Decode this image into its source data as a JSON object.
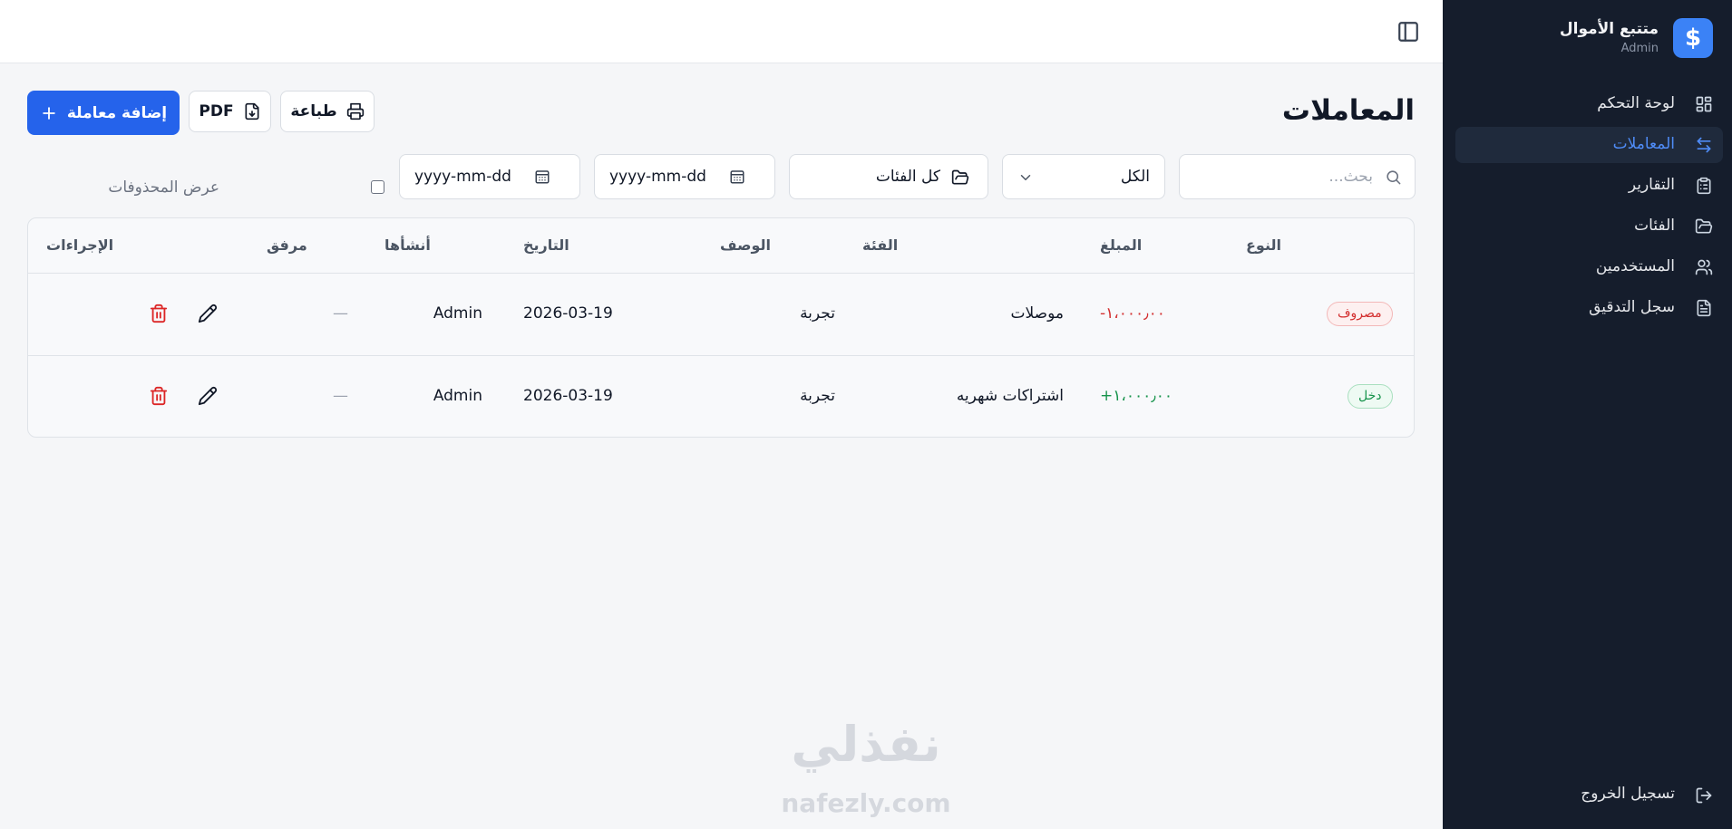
{
  "app": {
    "title": "متتبع الأموال",
    "user_role": "Admin",
    "logo_glyph": "$"
  },
  "sidebar": {
    "items": [
      {
        "label": "لوحة التحكم",
        "icon": "dashboard-grid-icon",
        "active": false
      },
      {
        "label": "المعاملات",
        "icon": "arrows-exchange-icon",
        "active": true
      },
      {
        "label": "التقارير",
        "icon": "clipboard-icon",
        "active": false
      },
      {
        "label": "الفئات",
        "icon": "folder-icon",
        "active": false
      },
      {
        "label": "المستخدمين",
        "icon": "users-icon",
        "active": false
      },
      {
        "label": "سجل التدقيق",
        "icon": "file-text-icon",
        "active": false
      }
    ],
    "logout_label": "تسجيل الخروج"
  },
  "page": {
    "title": "المعاملات",
    "add_button": "إضافة معاملة",
    "pdf_button": "PDF",
    "print_button": "طباعة"
  },
  "filters": {
    "search_placeholder": "بحث...",
    "type_value": "الكل",
    "category_value": "كل الفئات",
    "date_from_placeholder": "yyyy-mm-dd",
    "date_to_placeholder": "yyyy-mm-dd",
    "show_deleted_label": "عرض المحذوفات",
    "show_deleted_checked": false
  },
  "table": {
    "headers": {
      "type": "النوع",
      "amount": "المبلغ",
      "category": "الفئة",
      "description": "الوصف",
      "date": "التاريخ",
      "created_by": "أنشأها",
      "attachment": "مرفق",
      "actions": "الإجراءات"
    },
    "rows": [
      {
        "type": "مصروف",
        "type_kind": "expense",
        "amount": "-١،٠٠٠٫٠٠",
        "description": "موصلات",
        "category": "تجربة",
        "date": "2026-03-19",
        "created_by": "Admin",
        "attachment": "—"
      },
      {
        "type": "دخل",
        "type_kind": "income",
        "amount": "+١،٠٠٠٫٠٠",
        "description": "اشتراكات شهريه",
        "category": "تجربة",
        "date": "2026-03-19",
        "created_by": "Admin",
        "attachment": "—"
      }
    ]
  },
  "watermark": {
    "arabic": "نفذلي",
    "latin": "nafezly.com"
  },
  "colors": {
    "sidebar_bg": "#151d2c",
    "accent": "#2563eb",
    "active_nav": "#4f8cf7",
    "expense": "#d32f2f",
    "income": "#16934b"
  }
}
